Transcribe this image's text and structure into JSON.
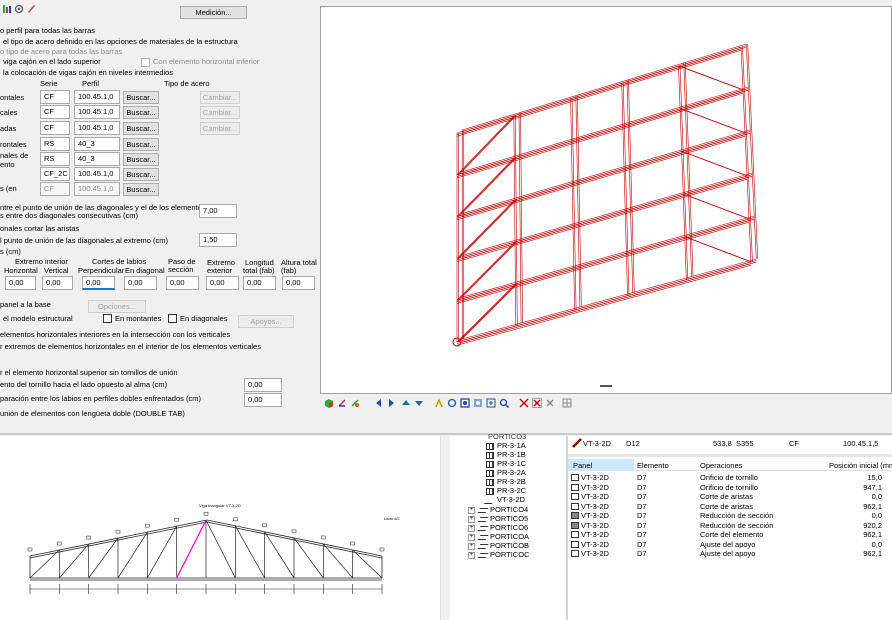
{
  "toolbar_top": {
    "medicion_button": "Medición..."
  },
  "options": {
    "opt1": "o perfil para todas las barras",
    "opt2": "el tipo de acero definido en las opciones de materiales de la estructura",
    "opt3": "o tipo de acero para todas las barras",
    "opt4": "viga cajón en el lado superior",
    "opt4_right": "Con elemento horizontal inferior",
    "opt5": "la colocación de vigas cajón en niveles intermedios"
  },
  "profile_table": {
    "col_serie": "Serie",
    "col_perfil": "Perfil",
    "col_acero": "Tipo de acero",
    "rows": [
      {
        "label": "ontales",
        "serie": "CF",
        "perfil": "100.45.1,0",
        "buscar": "Buscar...",
        "cambiar": "Cambiar..."
      },
      {
        "label": "cales",
        "serie": "CF",
        "perfil": "100.45.1,0",
        "buscar": "Buscar...",
        "cambiar": "Cambiar..."
      },
      {
        "label": "adas",
        "serie": "CF",
        "perfil": "100.45.1,0",
        "buscar": "Buscar...",
        "cambiar": "Cambiar..."
      },
      {
        "label": "rontales",
        "serie": "RS",
        "perfil": "40_3",
        "buscar": "Buscar..."
      },
      {
        "label": "nales de",
        "label2": "ento",
        "serie": "RS",
        "perfil": "40_3",
        "buscar": "Buscar..."
      },
      {
        "label": "",
        "serie": "CF_2C",
        "perfil": "100.45.1,0",
        "buscar": "Buscar..."
      },
      {
        "label": "s (en",
        "serie": "CF",
        "perfil": "100.45.1,0",
        "buscar": "Buscar..."
      }
    ]
  },
  "distances": {
    "d1_line1": "ntre el punto de unión de las diagonales y el de los elementos",
    "d1_line2": "s entre dos diagonales consecutivas (cm)",
    "d1_value": "7,00",
    "d2": "onales cortar las aristas",
    "d3": "l punto de unión de las diagonales al extremo (cm)",
    "d3_value": "1,50",
    "d4": "s (cm)"
  },
  "cuts": {
    "h_extremo_interior": "Extremo interior",
    "h_horizontal": "Horizontal",
    "h_vertical": "Vertical",
    "h_cortes_labios": "Cortes de labios",
    "h_perpendicular": "Perpendicular",
    "h_en_diagonal": "En diagonal",
    "h_paso_seccion_1": "Paso de",
    "h_paso_seccion_2": "sección",
    "h_extremo_exterior_1": "Extremo",
    "h_extremo_exterior_2": "exterior",
    "h_longitud_1": "Longitud",
    "h_longitud_2": "total (fab)",
    "h_altura_1": "Altura total",
    "h_altura_2": "(fab)",
    "values": [
      "0,00",
      "0,00",
      "0,00",
      "0,00",
      "0,00",
      "0,00",
      "0,00",
      "0,00"
    ]
  },
  "panel_base": {
    "label": "panel a la base",
    "opciones": "Opciones...",
    "modelo": "el modelo estructural",
    "en_montantes": "En montantes",
    "en_diagonales": "En diagonales",
    "apoyos": "Apoyos..."
  },
  "bottom_opts": {
    "b1": "elementos horizontales interiores en la intersección con los verticales",
    "b2": "r extremos de elementos horizontales en el interior de los elementos verticales",
    "b3": "r el elemento horizontal superior sin tornillos de unión",
    "b4": "ento del tornillo hacia el lado opuesto al alma (cm)",
    "b4_value": "0,00",
    "b5": "paración entre los labios en perfiles dobles enfrentados (cm)",
    "b5_value": "0,00",
    "b6": "unión de elementos con lengüeta doble (DOUBLE TAB)"
  },
  "drawing": {
    "title": "Viga triangular VT-3-2D",
    "side_note": "Lado 4/2"
  },
  "tree": {
    "top_item": "PORTICO3",
    "children": [
      "PR-3-1A",
      "PR-3-1B",
      "PR-3-1C",
      "PR-3-2A",
      "PR-3-2B",
      "PR-3-2C",
      "VT-3-2D"
    ],
    "porticos": [
      "PORTICO4",
      "PORTICO5",
      "PORTICO6",
      "PORTICOA",
      "PORTICOB",
      "PORTICOC"
    ]
  },
  "detail": {
    "header": {
      "name": "VT-3-2D",
      "element": "D12",
      "length": "533,8",
      "steel": "S355",
      "type": "CF",
      "profile": "100.45.1,5"
    },
    "columns": {
      "panel": "Panel",
      "elemento": "Elemento",
      "operaciones": "Operaciones",
      "posicion": "Posición inicial (mm)"
    },
    "rows": [
      {
        "panel": "VT-3-2D",
        "elemento": "D7",
        "op": "Orificio de tornillo",
        "pos": "15,0"
      },
      {
        "panel": "VT-3-2D",
        "elemento": "D7",
        "op": "Orificio de tornillo",
        "pos": "947,1"
      },
      {
        "panel": "VT-3-2D",
        "elemento": "D7",
        "op": "Corte de aristas",
        "pos": "0,0"
      },
      {
        "panel": "VT-3-2D",
        "elemento": "D7",
        "op": "Corte de aristas",
        "pos": "962,1"
      },
      {
        "panel": "VT-3-2D",
        "elemento": "D7",
        "op": "Reducción de sección",
        "pos": "0,0"
      },
      {
        "panel": "VT-3-2D",
        "elemento": "D7",
        "op": "Reducción de sección",
        "pos": "920,2"
      },
      {
        "panel": "VT-3-2D",
        "elemento": "D7",
        "op": "Corte del elemento",
        "pos": "962,1"
      },
      {
        "panel": "VT-3-2D",
        "elemento": "D7",
        "op": "Ajuste del apoyo",
        "pos": "0,0"
      },
      {
        "panel": "VT-3-2D",
        "elemento": "D7",
        "op": "Ajuste del apoyo",
        "pos": "962,1"
      }
    ]
  },
  "colors": {
    "structure": "#c00000",
    "highlight": "#ff00ff",
    "selection": "#cce8ff"
  }
}
